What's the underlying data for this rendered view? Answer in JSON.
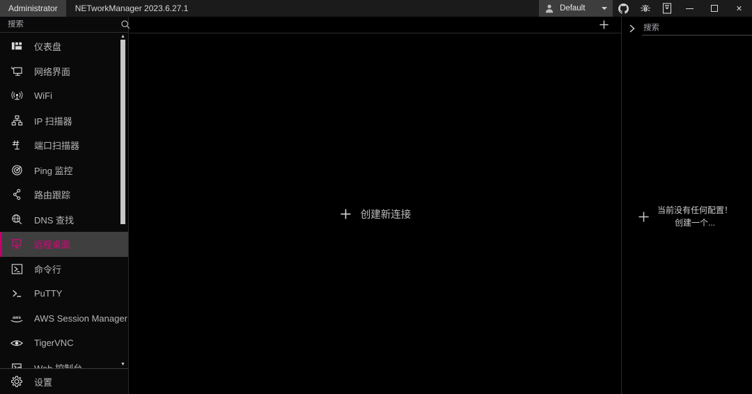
{
  "titlebar": {
    "admin_tab": "Administrator",
    "app_title": "NETworkManager 2023.6.27.1",
    "profile_name": "Default",
    "profile_caret": "▼",
    "icons": [
      {
        "name": "github-icon",
        "label": "GitHub"
      },
      {
        "name": "bug-icon",
        "label": "Report a bug"
      },
      {
        "name": "book-icon",
        "label": "Documentation"
      }
    ],
    "window_buttons": {
      "minimize": "minimize-button",
      "maximize": "maximize-button",
      "close": "✕"
    }
  },
  "sidebar": {
    "search_placeholder": "搜索",
    "search_value": "",
    "search_icon": "search-icon",
    "pin_icon": "pin-icon",
    "scroll_up_glyph": "▲",
    "scroll_down_glyph": "▼",
    "items": [
      {
        "label": "仪表盘",
        "icon": "dashboard-icon",
        "active": false
      },
      {
        "label": "网络界面",
        "icon": "network-interface-icon",
        "active": false
      },
      {
        "label": "WiFi",
        "icon": "wifi-icon",
        "active": false
      },
      {
        "label": "IP 扫描器",
        "icon": "ip-scanner-icon",
        "active": false
      },
      {
        "label": "端口扫描器",
        "icon": "port-scanner-icon",
        "active": false
      },
      {
        "label": "Ping 监控",
        "icon": "ping-monitor-icon",
        "active": false
      },
      {
        "label": "路由跟踪",
        "icon": "traceroute-icon",
        "active": false
      },
      {
        "label": "DNS 查找",
        "icon": "dns-lookup-icon",
        "active": false
      },
      {
        "label": "远程桌面",
        "icon": "remote-desktop-icon",
        "active": true
      },
      {
        "label": "命令行",
        "icon": "powershell-icon",
        "active": false
      },
      {
        "label": "PuTTY",
        "icon": "putty-icon",
        "active": false
      },
      {
        "label": "AWS Session Manager",
        "icon": "aws-icon",
        "active": false
      },
      {
        "label": "TigerVNC",
        "icon": "eye-icon",
        "active": false
      },
      {
        "label": "Web 控制台",
        "icon": "web-console-icon",
        "active": false
      }
    ],
    "settings": {
      "label": "设置",
      "icon": "gear-icon"
    }
  },
  "center": {
    "add_icon": "plus-icon",
    "create_label": "创建新连接",
    "create_icon": "plus-icon"
  },
  "right": {
    "expand_icon": "chevron-right-icon",
    "search_placeholder": "搜索",
    "search_value": "",
    "search_icon": "search-icon",
    "add_icon": "plus-icon",
    "empty_icon": "plus-icon",
    "empty_line1": "当前没有任何配置！",
    "empty_line2": "创建一个..."
  },
  "colors": {
    "accent": "#e0007d",
    "accent_bar": "#c3006b",
    "selected_bg": "#3f3f3f",
    "titlebar_bg": "#1b1b1b",
    "tab_bg": "#3d3d3d",
    "sidebar_bg": "#0a0a0a",
    "panel_bg": "#000000",
    "text": "#b6b6b6",
    "divider": "#2b2b2b"
  }
}
